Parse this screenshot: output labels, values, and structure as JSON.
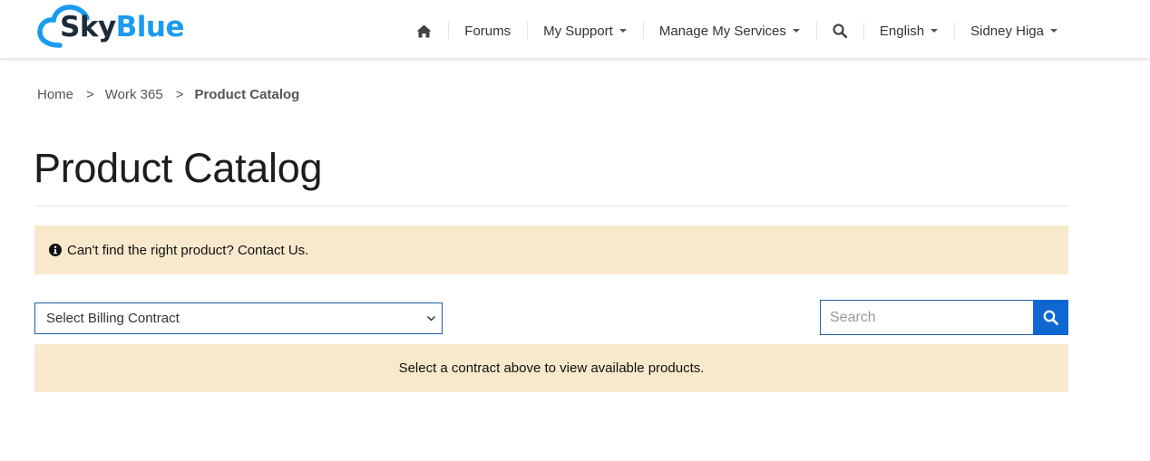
{
  "brand": {
    "part1": "Sky",
    "part2": "Blue",
    "colors": {
      "dark": "#1d2b3a",
      "accent": "#1a9bf0"
    }
  },
  "nav": {
    "home_icon": "home-icon",
    "items": [
      {
        "label": "Forums"
      },
      {
        "label": "My Support"
      },
      {
        "label": "Manage My Services"
      }
    ],
    "search_icon": "search-icon",
    "language": "English",
    "user": "Sidney Higa"
  },
  "breadcrumb": {
    "items": [
      "Home",
      "Work 365"
    ],
    "separator": ">",
    "current": "Product Catalog"
  },
  "page": {
    "title": "Product Catalog"
  },
  "alert": {
    "icon": "info-circle-icon",
    "text": "Can't find the right product? Contact Us."
  },
  "billing_select": {
    "value": "Select Billing Contract"
  },
  "search": {
    "placeholder": "Search",
    "button_color": "#0f67d2"
  },
  "notice": {
    "text": "Select a contract above to view available products."
  },
  "colors": {
    "alert_bg": "#f8e9cc",
    "border_blue": "#1f5fa3"
  }
}
